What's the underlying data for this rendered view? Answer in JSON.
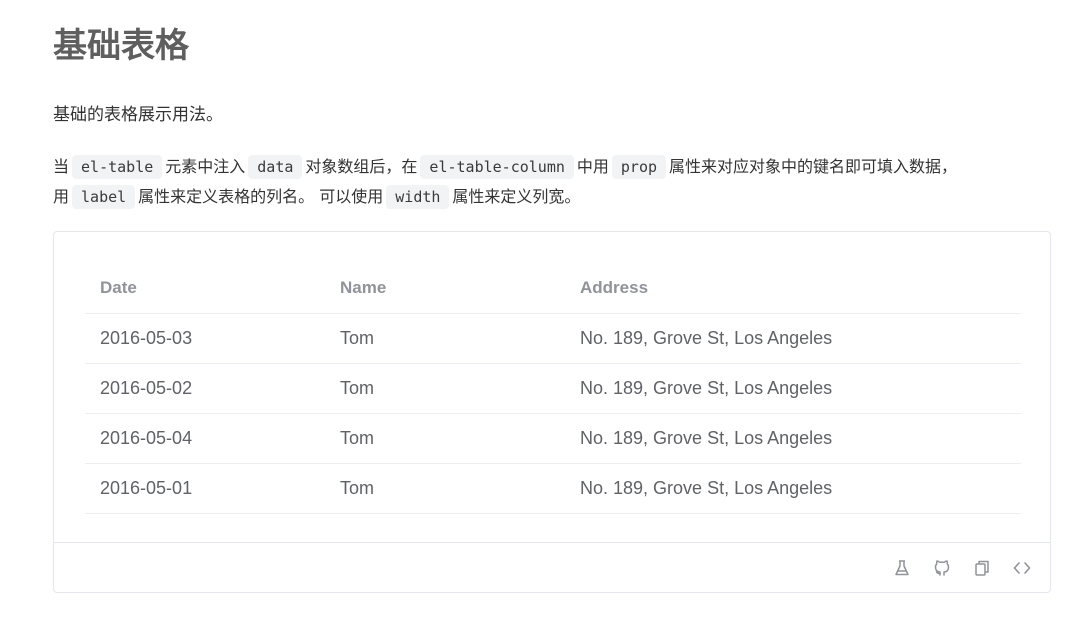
{
  "heading": "基础表格",
  "subtitle": "基础的表格展示用法。",
  "description": {
    "line1_parts": {
      "t1": "当",
      "c1": "el-table",
      "t2": "元素中注入",
      "c2": "data",
      "t3": "对象数组后，在",
      "c3": "el-table-column",
      "t4": "中用",
      "c4": "prop",
      "t5": "属性来对应对象中的键名即可填入数据，"
    },
    "line2_parts": {
      "t1": "用",
      "c1": "label",
      "t2": "属性来定义表格的列名。 可以使用",
      "c2": "width",
      "t3": "属性来定义列宽。"
    }
  },
  "table": {
    "headers": [
      "Date",
      "Name",
      "Address"
    ],
    "rows": [
      [
        "2016-05-03",
        "Tom",
        "No. 189, Grove St, Los Angeles"
      ],
      [
        "2016-05-02",
        "Tom",
        "No. 189, Grove St, Los Angeles"
      ],
      [
        "2016-05-04",
        "Tom",
        "No. 189, Grove St, Los Angeles"
      ],
      [
        "2016-05-01",
        "Tom",
        "No. 189, Grove St, Los Angeles"
      ]
    ]
  },
  "footer_icons": [
    "playground-flask-icon",
    "github-icon",
    "copy-icon",
    "code-icon"
  ],
  "colors": {
    "heading": "#5f5f5f",
    "code_bg": "#f2f3f5",
    "table_header": "#909399",
    "table_cell": "#606266",
    "border": "#ebeef5",
    "icon": "#909399"
  }
}
